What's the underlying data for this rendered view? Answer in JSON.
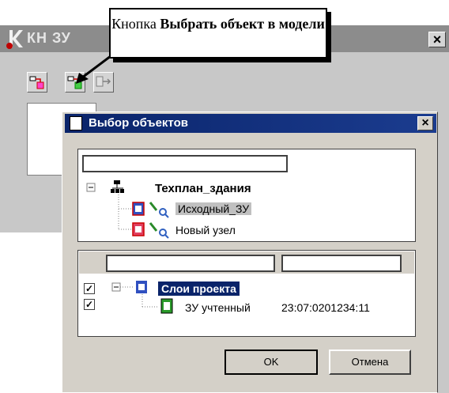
{
  "callout": {
    "prefix": "Кнопка",
    "bold": "Выбрать объект в модели"
  },
  "bg_window": {
    "title": "КН ЗУ",
    "close": "×"
  },
  "dialog": {
    "title": "Выбор объектов",
    "close": "×",
    "filter_value": "",
    "tree": {
      "root": "Техплан_здания",
      "children": [
        "Исходный_ЗУ",
        "Новый узел"
      ]
    },
    "layers": {
      "header_filter_1": "",
      "header_filter_2": "",
      "rows": [
        {
          "label": "Слои проекта",
          "checked": true
        },
        {
          "label": "ЗУ учтенный",
          "number": "23:07:0201234:11",
          "checked": true
        }
      ]
    },
    "ok_label": "OK",
    "cancel_label": "Отмена"
  },
  "colors": {
    "dialog_title": "#0a246a",
    "selected_highlight": "#0a246a",
    "bg_title": "#8c8c8c"
  },
  "icons": [
    "app-logo-icon",
    "select-object-icon",
    "select-in-model-icon",
    "export-icon",
    "tree-collapse-icon",
    "tree-node-icon",
    "layer-icon",
    "magnifier-pencil-icon"
  ]
}
